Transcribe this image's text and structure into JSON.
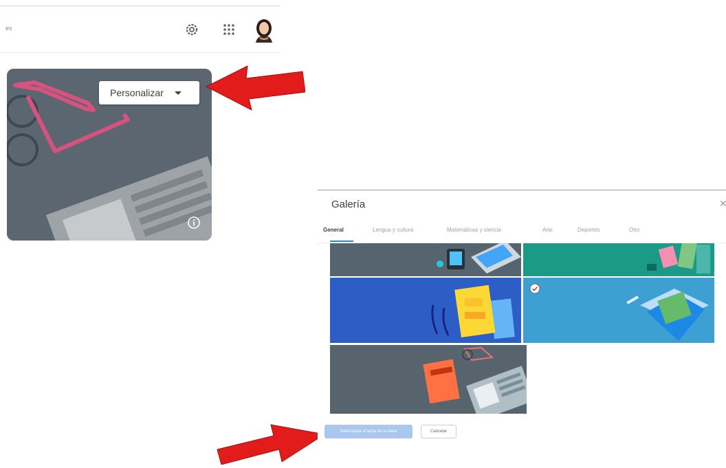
{
  "header": {
    "truncated_text": "es",
    "settings_icon": "gear-icon",
    "apps_icon": "apps-grid-icon",
    "avatar": "user-avatar"
  },
  "banner": {
    "customize_label": "Personalizar",
    "customize_icon": "caret-down-icon",
    "info_icon": "info-icon",
    "colors": {
      "background": "#5b6670",
      "glasses": "#d7527f"
    }
  },
  "annotations": {
    "arrow_color": "#e21b1b"
  },
  "gallery": {
    "title": "Galería",
    "close_icon": "close-icon",
    "tabs": [
      {
        "label": "General",
        "active": true
      },
      {
        "label": "Lengua y cultura",
        "active": false
      },
      {
        "label": "Matemáticas y ciencia",
        "active": false
      },
      {
        "label": "Arte",
        "active": false
      },
      {
        "label": "Deportes",
        "active": false
      },
      {
        "label": "Otro",
        "active": false
      }
    ],
    "tiles": [
      {
        "name": "tablet-laptop-theme",
        "color": "#55646e",
        "selected": false
      },
      {
        "name": "books-teal-theme",
        "color": "#1b9b87",
        "selected": false
      },
      {
        "name": "notebook-headphones-theme",
        "color": "#2c5ec6",
        "selected": false
      },
      {
        "name": "folder-envelope-theme",
        "color": "#3ea0d2",
        "selected": true
      },
      {
        "name": "book-glasses-newspaper-theme",
        "color": "#57646d",
        "selected": false
      }
    ],
    "primary_button": "Seleccionar el tema de la clase",
    "cancel_button": "Cancelar"
  }
}
